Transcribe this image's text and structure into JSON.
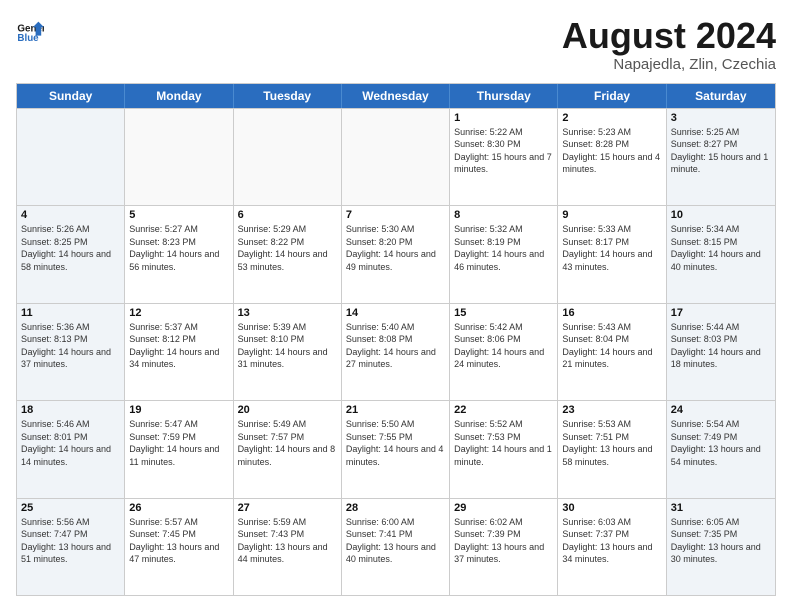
{
  "header": {
    "logo_general": "General",
    "logo_blue": "Blue",
    "month_title": "August 2024",
    "subtitle": "Napajedla, Zlin, Czechia"
  },
  "weekdays": [
    "Sunday",
    "Monday",
    "Tuesday",
    "Wednesday",
    "Thursday",
    "Friday",
    "Saturday"
  ],
  "rows": [
    [
      {
        "day": "",
        "info": "",
        "empty": true
      },
      {
        "day": "",
        "info": "",
        "empty": true
      },
      {
        "day": "",
        "info": "",
        "empty": true
      },
      {
        "day": "",
        "info": "",
        "empty": true
      },
      {
        "day": "1",
        "info": "Sunrise: 5:22 AM\nSunset: 8:30 PM\nDaylight: 15 hours and 7 minutes.",
        "empty": false
      },
      {
        "day": "2",
        "info": "Sunrise: 5:23 AM\nSunset: 8:28 PM\nDaylight: 15 hours and 4 minutes.",
        "empty": false
      },
      {
        "day": "3",
        "info": "Sunrise: 5:25 AM\nSunset: 8:27 PM\nDaylight: 15 hours and 1 minute.",
        "empty": false
      }
    ],
    [
      {
        "day": "4",
        "info": "Sunrise: 5:26 AM\nSunset: 8:25 PM\nDaylight: 14 hours and 58 minutes.",
        "empty": false
      },
      {
        "day": "5",
        "info": "Sunrise: 5:27 AM\nSunset: 8:23 PM\nDaylight: 14 hours and 56 minutes.",
        "empty": false
      },
      {
        "day": "6",
        "info": "Sunrise: 5:29 AM\nSunset: 8:22 PM\nDaylight: 14 hours and 53 minutes.",
        "empty": false
      },
      {
        "day": "7",
        "info": "Sunrise: 5:30 AM\nSunset: 8:20 PM\nDaylight: 14 hours and 49 minutes.",
        "empty": false
      },
      {
        "day": "8",
        "info": "Sunrise: 5:32 AM\nSunset: 8:19 PM\nDaylight: 14 hours and 46 minutes.",
        "empty": false
      },
      {
        "day": "9",
        "info": "Sunrise: 5:33 AM\nSunset: 8:17 PM\nDaylight: 14 hours and 43 minutes.",
        "empty": false
      },
      {
        "day": "10",
        "info": "Sunrise: 5:34 AM\nSunset: 8:15 PM\nDaylight: 14 hours and 40 minutes.",
        "empty": false
      }
    ],
    [
      {
        "day": "11",
        "info": "Sunrise: 5:36 AM\nSunset: 8:13 PM\nDaylight: 14 hours and 37 minutes.",
        "empty": false
      },
      {
        "day": "12",
        "info": "Sunrise: 5:37 AM\nSunset: 8:12 PM\nDaylight: 14 hours and 34 minutes.",
        "empty": false
      },
      {
        "day": "13",
        "info": "Sunrise: 5:39 AM\nSunset: 8:10 PM\nDaylight: 14 hours and 31 minutes.",
        "empty": false
      },
      {
        "day": "14",
        "info": "Sunrise: 5:40 AM\nSunset: 8:08 PM\nDaylight: 14 hours and 27 minutes.",
        "empty": false
      },
      {
        "day": "15",
        "info": "Sunrise: 5:42 AM\nSunset: 8:06 PM\nDaylight: 14 hours and 24 minutes.",
        "empty": false
      },
      {
        "day": "16",
        "info": "Sunrise: 5:43 AM\nSunset: 8:04 PM\nDaylight: 14 hours and 21 minutes.",
        "empty": false
      },
      {
        "day": "17",
        "info": "Sunrise: 5:44 AM\nSunset: 8:03 PM\nDaylight: 14 hours and 18 minutes.",
        "empty": false
      }
    ],
    [
      {
        "day": "18",
        "info": "Sunrise: 5:46 AM\nSunset: 8:01 PM\nDaylight: 14 hours and 14 minutes.",
        "empty": false
      },
      {
        "day": "19",
        "info": "Sunrise: 5:47 AM\nSunset: 7:59 PM\nDaylight: 14 hours and 11 minutes.",
        "empty": false
      },
      {
        "day": "20",
        "info": "Sunrise: 5:49 AM\nSunset: 7:57 PM\nDaylight: 14 hours and 8 minutes.",
        "empty": false
      },
      {
        "day": "21",
        "info": "Sunrise: 5:50 AM\nSunset: 7:55 PM\nDaylight: 14 hours and 4 minutes.",
        "empty": false
      },
      {
        "day": "22",
        "info": "Sunrise: 5:52 AM\nSunset: 7:53 PM\nDaylight: 14 hours and 1 minute.",
        "empty": false
      },
      {
        "day": "23",
        "info": "Sunrise: 5:53 AM\nSunset: 7:51 PM\nDaylight: 13 hours and 58 minutes.",
        "empty": false
      },
      {
        "day": "24",
        "info": "Sunrise: 5:54 AM\nSunset: 7:49 PM\nDaylight: 13 hours and 54 minutes.",
        "empty": false
      }
    ],
    [
      {
        "day": "25",
        "info": "Sunrise: 5:56 AM\nSunset: 7:47 PM\nDaylight: 13 hours and 51 minutes.",
        "empty": false
      },
      {
        "day": "26",
        "info": "Sunrise: 5:57 AM\nSunset: 7:45 PM\nDaylight: 13 hours and 47 minutes.",
        "empty": false
      },
      {
        "day": "27",
        "info": "Sunrise: 5:59 AM\nSunset: 7:43 PM\nDaylight: 13 hours and 44 minutes.",
        "empty": false
      },
      {
        "day": "28",
        "info": "Sunrise: 6:00 AM\nSunset: 7:41 PM\nDaylight: 13 hours and 40 minutes.",
        "empty": false
      },
      {
        "day": "29",
        "info": "Sunrise: 6:02 AM\nSunset: 7:39 PM\nDaylight: 13 hours and 37 minutes.",
        "empty": false
      },
      {
        "day": "30",
        "info": "Sunrise: 6:03 AM\nSunset: 7:37 PM\nDaylight: 13 hours and 34 minutes.",
        "empty": false
      },
      {
        "day": "31",
        "info": "Sunrise: 6:05 AM\nSunset: 7:35 PM\nDaylight: 13 hours and 30 minutes.",
        "empty": false
      }
    ]
  ]
}
